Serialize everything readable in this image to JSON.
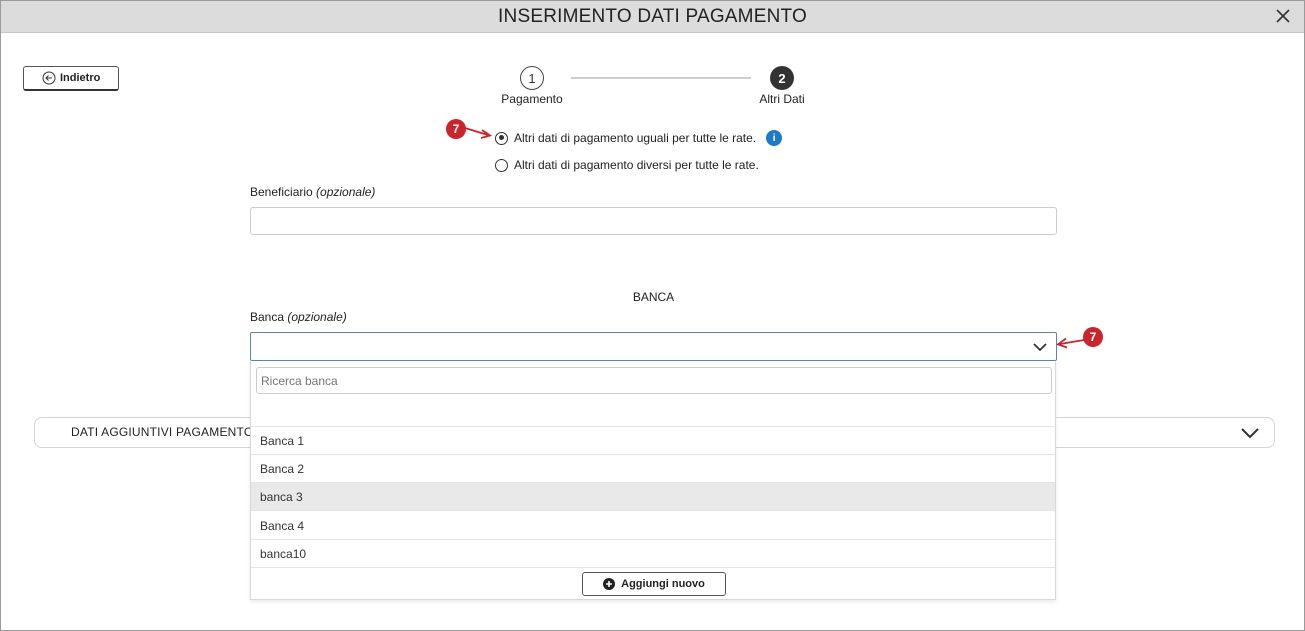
{
  "window": {
    "title": "INSERIMENTO DATI PAGAMENTO"
  },
  "back_button": {
    "label": "Indietro"
  },
  "steps": [
    {
      "number": "1",
      "label": "Pagamento",
      "active": false
    },
    {
      "number": "2",
      "label": "Altri Dati",
      "active": true
    }
  ],
  "radio_options": [
    {
      "label": "Altri dati di pagamento uguali per tutte le rate.",
      "checked": true
    },
    {
      "label": "Altri dati di pagamento diversi per tutte le rate.",
      "checked": false
    }
  ],
  "annotation_badges": [
    "7",
    "7"
  ],
  "info_icon": "i",
  "beneficiario": {
    "label": "Beneficiario",
    "optional": "(opzionale)",
    "value": ""
  },
  "banca_section": {
    "title": "BANCA"
  },
  "banca": {
    "label": "Banca",
    "optional": "(opzionale)",
    "value": ""
  },
  "bank_dropdown": {
    "search_placeholder": "Ricerca banca",
    "options": [
      "Banca 1",
      "Banca 2",
      "banca 3",
      "Banca 4",
      "banca10"
    ],
    "highlighted_index": 2,
    "add_button_label": "Aggiungi nuovo"
  },
  "accordion": {
    "label": "DATI AGGIUNTIVI PAGAMENTO"
  },
  "colors": {
    "accent_red": "#c8252c",
    "info_blue": "#1e7ac6",
    "titlebar": "#dcdcdc"
  }
}
